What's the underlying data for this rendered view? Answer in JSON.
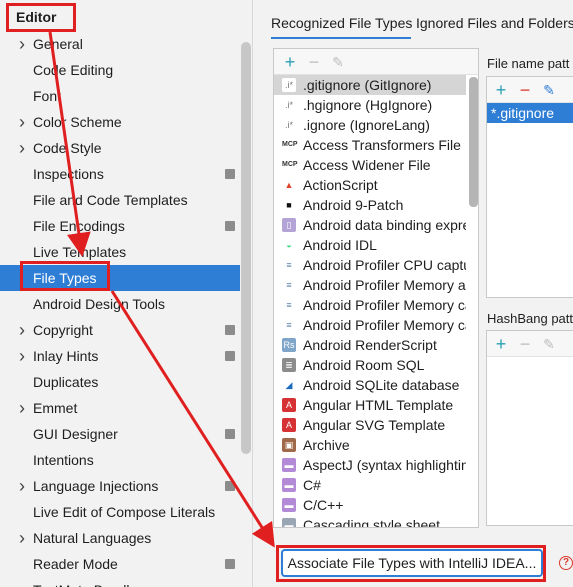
{
  "sidebar": {
    "header": "Editor",
    "items": [
      {
        "label": "General",
        "arrow": true,
        "badge": false
      },
      {
        "label": "Code Editing",
        "arrow": false,
        "badge": false
      },
      {
        "label": "Font",
        "arrow": false,
        "badge": false
      },
      {
        "label": "Color Scheme",
        "arrow": true,
        "badge": false
      },
      {
        "label": "Code Style",
        "arrow": true,
        "badge": false
      },
      {
        "label": "Inspections",
        "arrow": false,
        "badge": true
      },
      {
        "label": "File and Code Templates",
        "arrow": false,
        "badge": false
      },
      {
        "label": "File Encodings",
        "arrow": false,
        "badge": true
      },
      {
        "label": "Live Templates",
        "arrow": false,
        "badge": false
      },
      {
        "label": "File Types",
        "arrow": false,
        "badge": false,
        "selected": true
      },
      {
        "label": "Android Design Tools",
        "arrow": false,
        "badge": false
      },
      {
        "label": "Copyright",
        "arrow": true,
        "badge": true
      },
      {
        "label": "Inlay Hints",
        "arrow": true,
        "badge": true
      },
      {
        "label": "Duplicates",
        "arrow": false,
        "badge": false
      },
      {
        "label": "Emmet",
        "arrow": true,
        "badge": false
      },
      {
        "label": "GUI Designer",
        "arrow": false,
        "badge": true
      },
      {
        "label": "Intentions",
        "arrow": false,
        "badge": false
      },
      {
        "label": "Language Injections",
        "arrow": true,
        "badge": true
      },
      {
        "label": "Live Edit of Compose Literals",
        "arrow": false,
        "badge": false
      },
      {
        "label": "Natural Languages",
        "arrow": true,
        "badge": false
      },
      {
        "label": "Reader Mode",
        "arrow": false,
        "badge": true
      },
      {
        "label": "TextMate Bundles",
        "arrow": false,
        "badge": false
      }
    ]
  },
  "tabs": {
    "recognized": "Recognized File Types",
    "ignored": "Ignored Files and Folders"
  },
  "file_types": [
    {
      "name": ".gitignore (GitIgnore)",
      "icon": "gitignore-icon",
      "selected": true
    },
    {
      "name": ".hgignore (HgIgnore)",
      "icon": "hgignore-icon"
    },
    {
      "name": ".ignore (IgnoreLang)",
      "icon": "ignore-icon"
    },
    {
      "name": "Access Transformers File",
      "icon": "mcp-icon"
    },
    {
      "name": "Access Widener File",
      "icon": "mcp-icon"
    },
    {
      "name": "ActionScript",
      "icon": "actionscript-icon"
    },
    {
      "name": "Android 9-Patch",
      "icon": "folder-icon"
    },
    {
      "name": "Android data binding expres",
      "icon": "android-file-icon"
    },
    {
      "name": "Android IDL",
      "icon": "android-icon"
    },
    {
      "name": "Android Profiler CPU captur",
      "icon": "profiler-icon"
    },
    {
      "name": "Android Profiler Memory allo",
      "icon": "profiler-icon"
    },
    {
      "name": "Android Profiler Memory ca",
      "icon": "profiler-icon"
    },
    {
      "name": "Android Profiler Memory ca",
      "icon": "profiler-icon"
    },
    {
      "name": "Android RenderScript",
      "icon": "renderscript-icon"
    },
    {
      "name": "Android Room SQL",
      "icon": "database-icon"
    },
    {
      "name": "Android SQLite database",
      "icon": "sqlite-icon"
    },
    {
      "name": "Angular HTML Template",
      "icon": "angular-icon"
    },
    {
      "name": "Angular SVG Template",
      "icon": "angular-icon"
    },
    {
      "name": "Archive",
      "icon": "archive-icon"
    },
    {
      "name": "AspectJ (syntax highlighting",
      "icon": "aspectj-icon"
    },
    {
      "name": "C#",
      "icon": "csharp-icon"
    },
    {
      "name": "C/C++",
      "icon": "cpp-icon"
    },
    {
      "name": "Cascading style sheet",
      "icon": "css-icon"
    }
  ],
  "file_name_patterns": {
    "title": "File name patt",
    "items": [
      "*.gitignore"
    ]
  },
  "hashbang_patterns": {
    "title": "HashBang patt"
  },
  "associate_button": "Associate File Types with IntelliJ IDEA...",
  "help_glyph": "?",
  "colors": {
    "accent": "#2f7ed6",
    "annotation": "#e02020",
    "add": "#2aa0b3",
    "remove": "#d9382b"
  }
}
